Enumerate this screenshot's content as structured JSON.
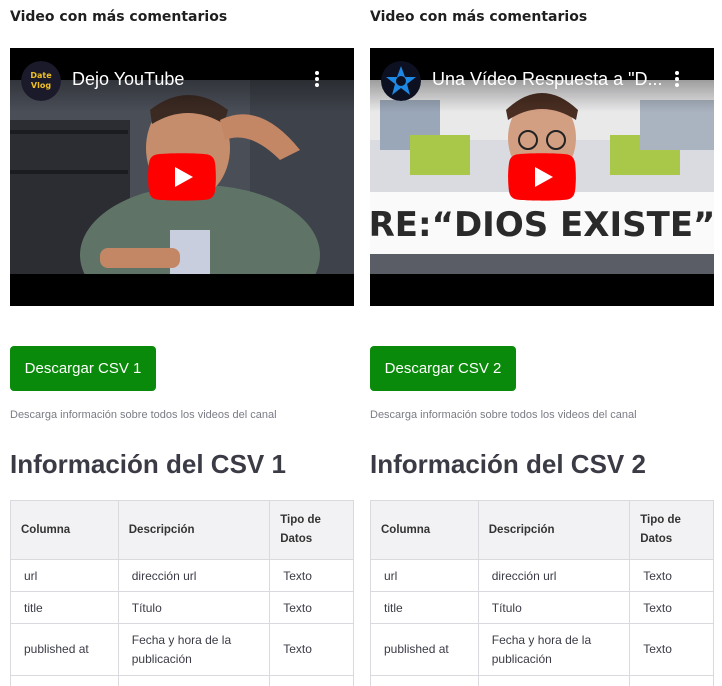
{
  "left": {
    "section_title": "Video con más comentarios",
    "video": {
      "title": "Dejo YouTube",
      "channel_avatar_text": "Date\nVlog"
    },
    "button_label": "Descargar CSV 1",
    "caption": "Descarga información sobre todos los videos del canal",
    "heading": "Información del CSV 1"
  },
  "right": {
    "section_title": "Video con más comentarios",
    "video": {
      "title": "Una Vídeo Respuesta a \"D...",
      "overlay_text": "RE:“DIOS EXISTE”"
    },
    "button_label": "Descargar CSV 2",
    "caption": "Descarga información sobre todos los videos del canal",
    "heading": "Información del CSV 2"
  },
  "table": {
    "headers": [
      "Columna",
      "Descripción",
      "Tipo de Datos"
    ],
    "rows": [
      [
        "url",
        "dirección url",
        "Texto"
      ],
      [
        "title",
        "Título",
        "Texto"
      ],
      [
        "published at",
        "Fecha y hora de la publicación",
        "Texto"
      ]
    ]
  },
  "colors": {
    "button": "#0a8a0a",
    "youtube_red": "#ff0000"
  },
  "icons": [
    "youtube-play-icon",
    "more-vert-icon"
  ]
}
